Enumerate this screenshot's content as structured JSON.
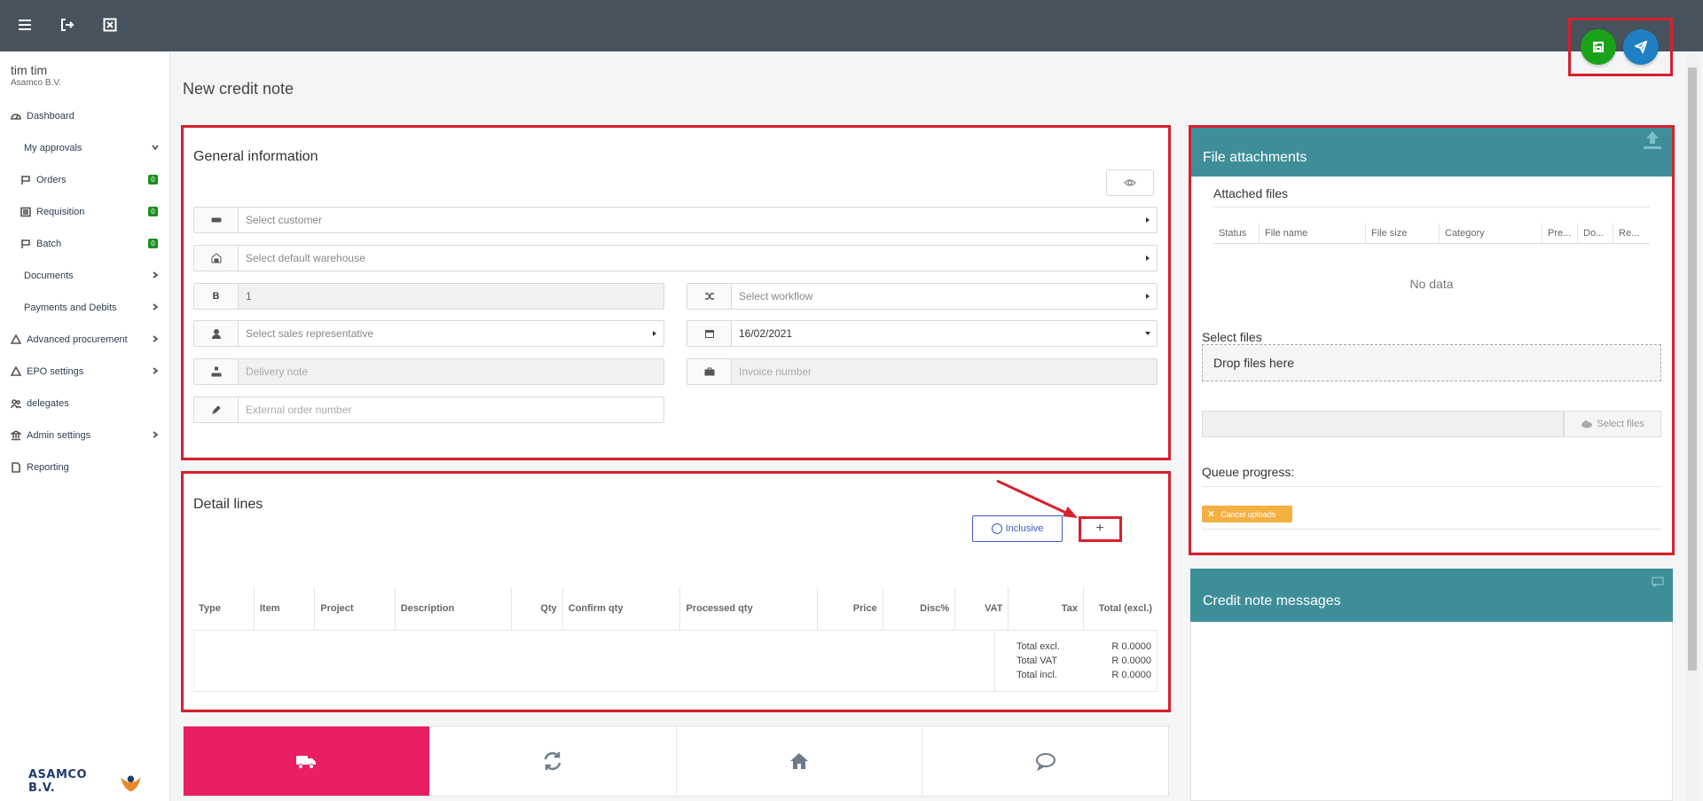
{
  "topbar": {
    "menu_icon": "hamburger-icon",
    "logout_icon": "sign-out-icon",
    "close_icon": "close-square-icon"
  },
  "actions": {
    "save_color": "#1aa31a",
    "send_color": "#1e7fc2"
  },
  "user": {
    "name": "tim tim",
    "company": "Asamco B.V."
  },
  "sidebar": {
    "items": [
      {
        "label": "Dashboard",
        "icon": "dashboard-icon"
      },
      {
        "label": "My approvals",
        "chevron": "down"
      },
      {
        "label": "Orders",
        "icon": "flag-icon",
        "badge": "0"
      },
      {
        "label": "Requisition",
        "icon": "list-icon",
        "badge": "0"
      },
      {
        "label": "Batch",
        "icon": "flag-icon",
        "badge": "0"
      },
      {
        "label": "Documents",
        "chevron": "right"
      },
      {
        "label": "Payments and Debits",
        "chevron": "right"
      },
      {
        "label": "Advanced procurement",
        "icon": "recycle-icon",
        "chevron": "right"
      },
      {
        "label": "EPO settings",
        "icon": "recycle-icon",
        "chevron": "right"
      },
      {
        "label": "delegates",
        "icon": "users-icon"
      },
      {
        "label": "Admin settings",
        "icon": "bank-icon",
        "chevron": "right"
      },
      {
        "label": "Reporting",
        "icon": "file-icon"
      }
    ],
    "logo_text": "ASAMCO B.V."
  },
  "page": {
    "title": "New credit note"
  },
  "general": {
    "title": "General information",
    "customer_placeholder": "Select customer",
    "warehouse_placeholder": "Select default warehouse",
    "number_addon": "B",
    "number_value": "1",
    "workflow_placeholder": "Select workflow",
    "salesrep_placeholder": "Select sales representative",
    "date_value": "16/02/2021",
    "delivery_placeholder": "Delivery note",
    "invoice_placeholder": "Invoice number",
    "external_placeholder": "External order number"
  },
  "detail": {
    "title": "Detail lines",
    "inclusive_label": "Inclusive",
    "add_label": "+",
    "columns": [
      "Type",
      "Item",
      "Project",
      "Description",
      "Qty",
      "Confirm qty",
      "Processed qty",
      "Price",
      "Disc%",
      "VAT",
      "Tax",
      "Total (excl.)"
    ],
    "totals": [
      {
        "label": "Total excl.",
        "value": "R 0.0000"
      },
      {
        "label": "Total VAT",
        "value": "R 0.0000"
      },
      {
        "label": "Total incl.",
        "value": "R 0.0000"
      }
    ]
  },
  "attachments": {
    "title": "File attachments",
    "attached_title": "Attached files",
    "columns": [
      "Status",
      "File name",
      "File size",
      "Category",
      "Pre...",
      "Do...",
      "Re..."
    ],
    "no_data": "No data",
    "select_files_label": "Select files",
    "drop_label": "Drop files here",
    "select_button": "Select files",
    "queue_label": "Queue progress:",
    "cancel_uploads": "Cancel uploads"
  },
  "messages": {
    "title": "Credit note messages"
  },
  "bottom_tabs": [
    {
      "icon": "truck-icon",
      "active_color": "#e91e63"
    },
    {
      "icon": "refresh-icon"
    },
    {
      "icon": "home-icon"
    },
    {
      "icon": "comment-icon"
    }
  ]
}
